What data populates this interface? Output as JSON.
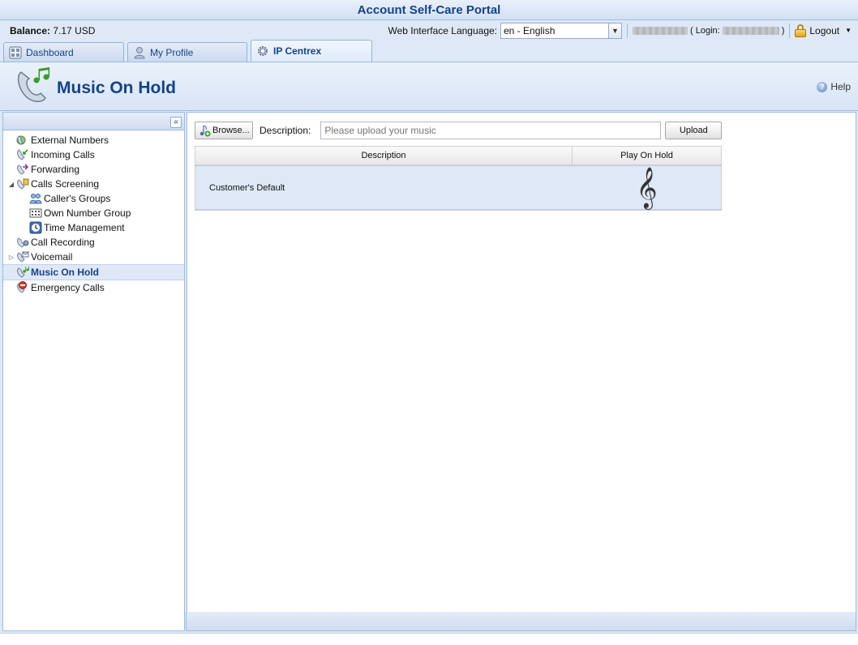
{
  "app": {
    "title": "Account Self-Care Portal"
  },
  "topbar": {
    "balance_label": "Balance:",
    "balance_value": "7.17 USD",
    "language_label": "Web Interface Language:",
    "language_value": "en - English",
    "login_open": "( Login:",
    "login_close": ")",
    "logout_label": "Logout"
  },
  "tabs": [
    {
      "label": "Dashboard",
      "icon": "dashboard-icon"
    },
    {
      "label": "My Profile",
      "icon": "user-icon"
    },
    {
      "label": "IP Centrex",
      "icon": "gear-icon",
      "active": true
    }
  ],
  "page": {
    "title": "Music On Hold",
    "help_label": "Help"
  },
  "sidebar": {
    "collapse_glyph": "«",
    "items": [
      {
        "label": "External Numbers",
        "icon": "external-numbers-icon"
      },
      {
        "label": "Incoming Calls",
        "icon": "incoming-calls-icon"
      },
      {
        "label": "Forwarding",
        "icon": "forwarding-icon"
      },
      {
        "label": "Calls Screening",
        "icon": "calls-screening-icon",
        "expanded": true
      },
      {
        "label": "Caller's Groups",
        "icon": "callers-groups-icon",
        "child": true
      },
      {
        "label": "Own Number Group",
        "icon": "number-group-icon",
        "child": true
      },
      {
        "label": "Time Management",
        "icon": "clock-icon",
        "child": true
      },
      {
        "label": "Call Recording",
        "icon": "call-recording-icon"
      },
      {
        "label": "Voicemail",
        "icon": "voicemail-icon",
        "collapsed": true
      },
      {
        "label": "Music On Hold",
        "icon": "music-on-hold-icon",
        "selected": true
      },
      {
        "label": "Emergency Calls",
        "icon": "emergency-calls-icon"
      }
    ]
  },
  "toolbar": {
    "browse_label": "Browse...",
    "description_label": "Description:",
    "description_placeholder": "Please upload your music",
    "upload_label": "Upload"
  },
  "grid": {
    "columns": [
      "Description",
      "Play On Hold"
    ],
    "rows": [
      {
        "description": "Customer's Default",
        "play_icon": "treble-clef-icon"
      }
    ]
  }
}
